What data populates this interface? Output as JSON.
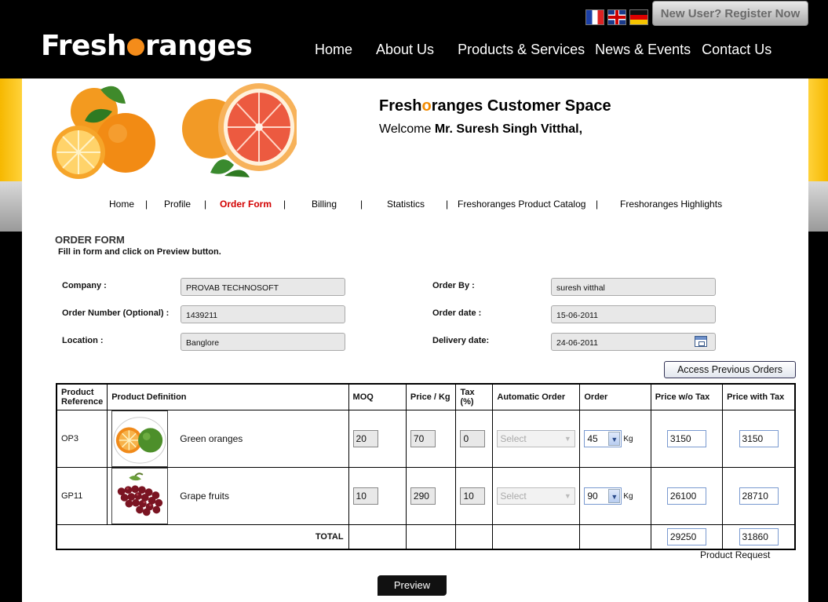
{
  "header": {
    "logo_left": "Fresh",
    "logo_right": "ranges",
    "register_label": "New User? Register Now",
    "nav": [
      "Home",
      "About Us",
      "Products & Services",
      "News & Events",
      "Contact Us"
    ]
  },
  "banner": {
    "title_left": "Fresh",
    "title_o": "o",
    "title_right": "ranges Customer Space",
    "welcome_prefix": "Welcome",
    "welcome_name": "Mr. Suresh Singh Vitthal,"
  },
  "subnav": {
    "home": "Home",
    "profile": "Profile",
    "order_form": "Order Form",
    "billing": "Billing",
    "statistics": "Statistics",
    "catalog": "Freshoranges Product Catalog",
    "highlights": "Freshoranges Highlights",
    "separator": "|"
  },
  "form": {
    "title": "ORDER FORM",
    "instruction": "Fill in form and click on Preview button.",
    "company_label": "Company :",
    "company_value": "PROVAB TECHNOSOFT",
    "order_number_label": "Order Number (Optional) :",
    "order_number_value": "1439211",
    "location_label": "Location :",
    "location_value": "Banglore",
    "order_by_label": "Order By :",
    "order_by_value": "suresh vitthal",
    "order_date_label": "Order date :",
    "order_date_value": "15-06-2011",
    "delivery_date_label": "Delivery date:",
    "delivery_date_value": "24-06-2011",
    "access_previous_label": "Access Previous Orders"
  },
  "table": {
    "headers": {
      "ref": "Product Reference",
      "definition": "Product Definition",
      "moq": "MOQ",
      "price": "Price / Kg",
      "tax": "Tax (%)",
      "auto_order": "Automatic Order",
      "order": "Order",
      "price_wo_tax": "Price w/o Tax",
      "price_with_tax": "Price with Tax"
    },
    "rows": [
      {
        "ref": "OP3",
        "name": "Green oranges",
        "moq": "20",
        "price": "70",
        "tax": "0",
        "auto": "Select",
        "order": "45",
        "unit": "Kg",
        "price_wo_tax": "3150",
        "price_with_tax": "3150"
      },
      {
        "ref": "GP11",
        "name": "Grape fruits",
        "moq": "10",
        "price": "290",
        "tax": "10",
        "auto": "Select",
        "order": "90",
        "unit": "Kg",
        "price_wo_tax": "26100",
        "price_with_tax": "28710"
      }
    ],
    "total_label": "TOTAL",
    "total_wo_tax": "29250",
    "total_with_tax": "31860"
  },
  "product_request_label": "Product Request",
  "preview_label": "Preview",
  "colors": {
    "accent_orange": "#f48c1a",
    "active_red": "#d20000",
    "band_yellow": "#f6b800"
  }
}
